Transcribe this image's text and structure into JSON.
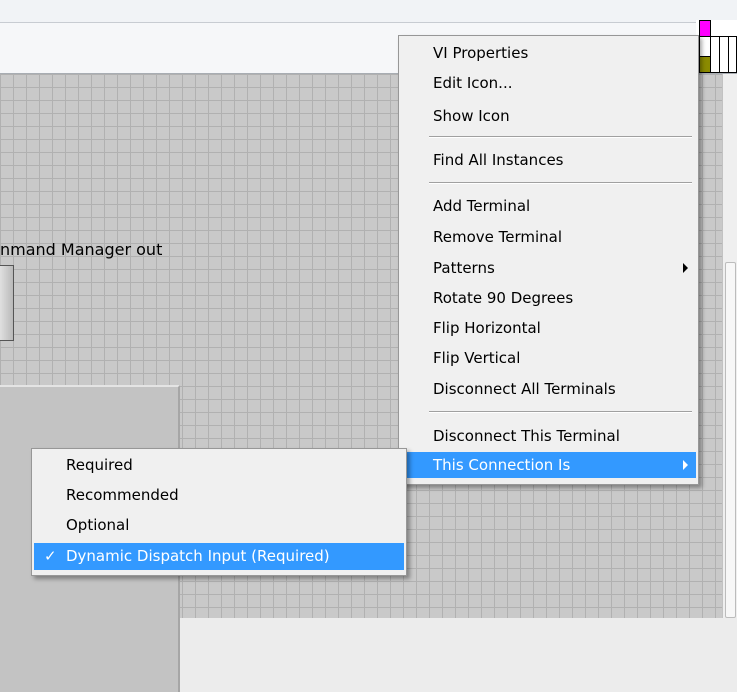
{
  "canvas": {
    "label": "nmand Manager out"
  },
  "context_menu": {
    "items": [
      {
        "label": "VI Properties"
      },
      {
        "label": "Edit Icon..."
      },
      {
        "label": "Show Icon"
      },
      {
        "label": "Find All Instances"
      },
      {
        "label": "Add Terminal"
      },
      {
        "label": "Remove Terminal"
      },
      {
        "label": "Patterns"
      },
      {
        "label": "Rotate 90 Degrees"
      },
      {
        "label": "Flip Horizontal"
      },
      {
        "label": "Flip Vertical"
      },
      {
        "label": "Disconnect All Terminals"
      },
      {
        "label": "Disconnect This Terminal"
      },
      {
        "label": "This Connection Is"
      }
    ]
  },
  "submenu": {
    "items": [
      {
        "label": "Required",
        "checked": false
      },
      {
        "label": "Recommended",
        "checked": false
      },
      {
        "label": "Optional",
        "checked": false
      },
      {
        "label": "Dynamic Dispatch Input (Required)",
        "checked": true
      }
    ],
    "check_glyph": "✓"
  },
  "colors": {
    "highlight": "#3399ff",
    "pane_selected": "#ff00ff",
    "pane_terminal": "#8b8b00"
  }
}
